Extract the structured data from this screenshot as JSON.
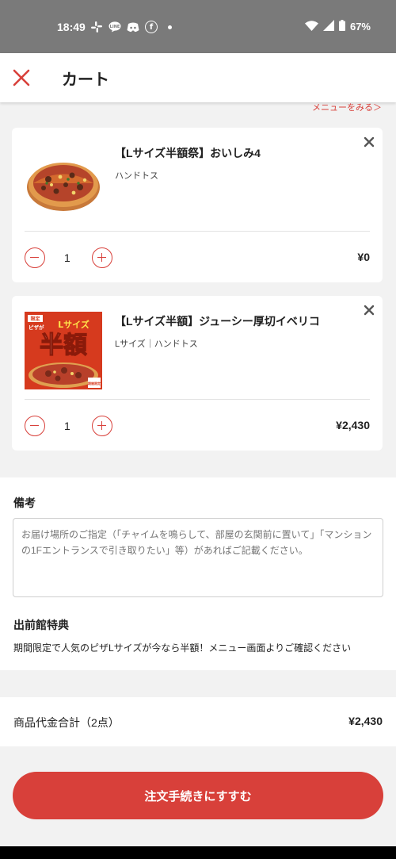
{
  "status_bar": {
    "time": "18:49",
    "battery": "67%",
    "icons_left": [
      "slack-icon",
      "line-icon",
      "discord-icon",
      "facebook-icon",
      "dot-icon"
    ],
    "icons_right": [
      "wifi-icon",
      "signal-icon",
      "battery-icon"
    ]
  },
  "header": {
    "title": "カート",
    "close_icon": "close-icon"
  },
  "menu_link": "メニューをみる＞",
  "cart_items": [
    {
      "name": "【Lサイズ半額祭】おいしみ4",
      "option": "ハンドトス",
      "quantity": "1",
      "price": "¥0"
    },
    {
      "name": "【Lサイズ半額】ジューシー厚切イベリコ",
      "option": "Lサイズ｜ハンドトス",
      "quantity": "1",
      "price": "¥2,430",
      "image_text": {
        "tag1": "限定",
        "tag2": "ピザが",
        "size": "Lサイズ",
        "headline": "半額",
        "corner": "期間限定"
      }
    }
  ],
  "notes": {
    "label": "備考",
    "placeholder": "お届け場所のご指定（「チャイムを鳴らして、部屋の玄関前に置いて」「マンションの1Fエントランスで引き取りたい」等）があればご記載ください。"
  },
  "benefit": {
    "label": "出前館特典",
    "text": "期間限定で人気のピザLサイズが今なら半額！メニュー画面よりご確認ください"
  },
  "total": {
    "label": "商品代金合計（2点）",
    "value": "¥2,430"
  },
  "order_button": "注文手続きにすすむ",
  "colors": {
    "accent": "#d8403a",
    "status_bar": "#7a7a7a",
    "background": "#f2f2f2"
  }
}
